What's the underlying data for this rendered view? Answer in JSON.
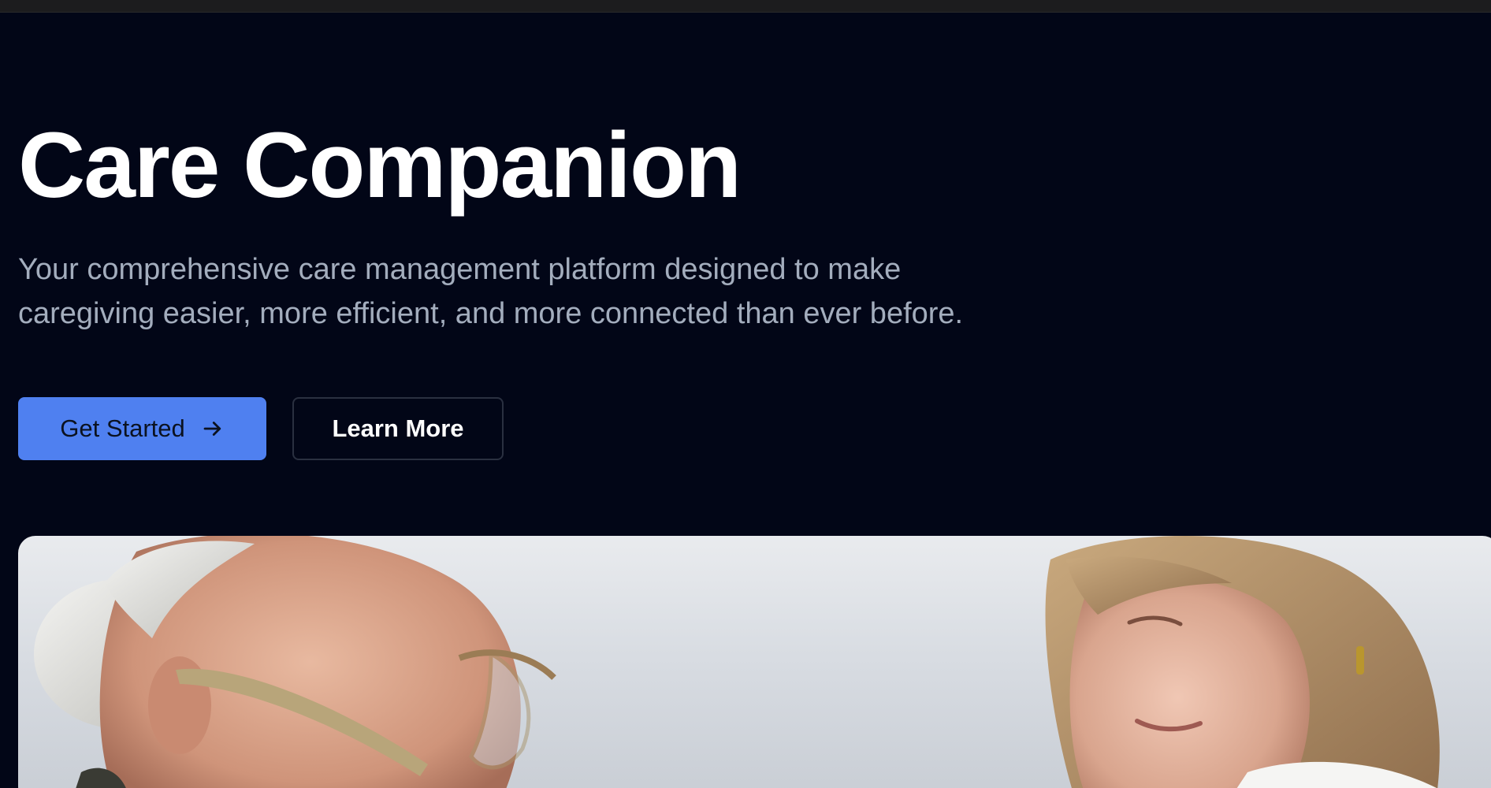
{
  "hero": {
    "title": "Care Companion",
    "subtitle": "Your comprehensive care management platform designed to make caregiving easier, more efficient, and more connected than ever before."
  },
  "actions": {
    "primary_label": "Get Started",
    "primary_icon": "arrow-right-icon",
    "secondary_label": "Learn More"
  },
  "image": {
    "alt": "Elderly man with glasses and a caregiver woman"
  },
  "colors": {
    "background": "#020617",
    "primary": "#4f80f0",
    "title": "#ffffff",
    "subtitle": "#a3adbd"
  }
}
